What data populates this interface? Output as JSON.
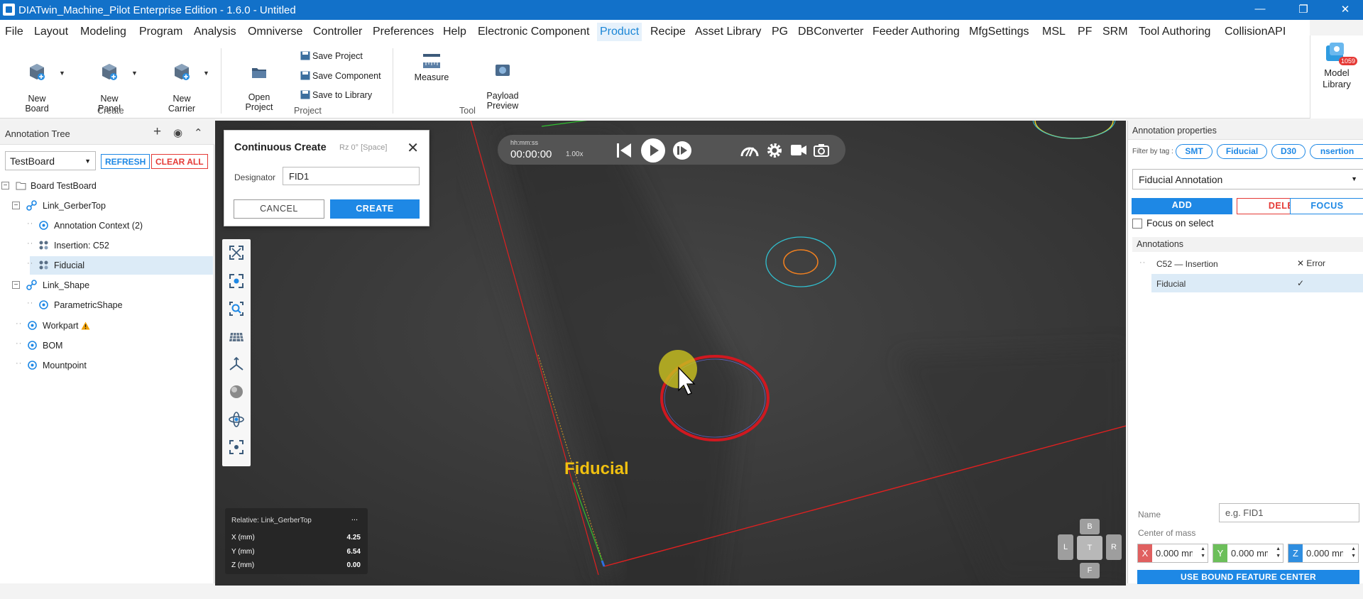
{
  "titlebar": {
    "title": "DIATwin_Machine_Pilot Enterprise Edition - 1.6.0 - Untitled",
    "minimize": "—",
    "restore": "❐",
    "close": "✕"
  },
  "menu": {
    "items": [
      "File",
      "Layout",
      "Modeling",
      "Program",
      "Analysis",
      "Omniverse",
      "Controller",
      "Preferences",
      "Help",
      "Electronic Component",
      "Product",
      "Recipe",
      "Asset Library",
      "PG",
      "DBConverter",
      "Feeder Authoring",
      "MfgSettings",
      "MSL",
      "PF",
      "SRM",
      "Tool Authoring",
      "CollisionAPI"
    ],
    "active": "Product",
    "collapse_icon": "⌃"
  },
  "ribbon": {
    "create": {
      "label": "Create",
      "new_board": "New\nBoard",
      "new_panel": "New\nPanel",
      "new_carrier": "New\nCarrier"
    },
    "project": {
      "label": "Project",
      "open_project": "Open\nProject",
      "save_project": "Save Project",
      "save_component": "Save Component",
      "save_to_library": "Save to Library"
    },
    "tool": {
      "label": "Tool",
      "measure": "Measure",
      "payload_preview": "Payload\nPreview"
    },
    "model_library": {
      "label": "Model\nLibrary",
      "badge": "1059"
    }
  },
  "tree": {
    "title": "Annotation Tree",
    "add_icon": "+",
    "eye_icon": "◉",
    "collapse_icon": "⌃",
    "board_select": "TestBoard",
    "refresh": "REFRESH",
    "clear_all": "CLEAR ALL",
    "nodes": {
      "board": "Board  TestBoard",
      "link_gerbertop": "Link_GerberTop",
      "annotation_context": "Annotation Context (2)",
      "insertion": "Insertion: C52",
      "fiducial": "Fiducial",
      "link_shape": "Link_Shape",
      "parametric_shape": "ParametricShape",
      "workpart": "Workpart",
      "bom": "BOM",
      "mountpoint": "Mountpoint"
    }
  },
  "playbar": {
    "format": "hh:mm:ss",
    "time": "00:00:00",
    "speed": "1.00x"
  },
  "dialog": {
    "title": "Continuous Create",
    "rz_hint": "Rz 0°  [Space]",
    "close": "✕",
    "designator_label": "Designator",
    "designator_value": "FID1",
    "cancel": "CANCEL",
    "create": "CREATE"
  },
  "coords": {
    "relative": "Relative: Link_GerberTop",
    "more": "...",
    "x_label": "X (mm)",
    "x_value": "4.25",
    "y_label": "Y (mm)",
    "y_value": "6.54",
    "z_label": "Z (mm)",
    "z_value": "0.00"
  },
  "viewport": {
    "fiducial_label": "Fiducial",
    "navcube": {
      "top": "B",
      "left": "L",
      "center": "T",
      "right": "R",
      "bottom": "F"
    }
  },
  "props": {
    "title": "Annotation properties",
    "filter_label": "Filter by tag :",
    "tags": [
      "SMT",
      "Fiducial",
      "D30",
      "nsertion"
    ],
    "annotation_type": "Fiducial Annotation",
    "add": "ADD",
    "delete": "DELETE",
    "focus": "FOCUS",
    "focus_on_select": "Focus on select",
    "annotations_header": "Annotations",
    "annotations": [
      {
        "name": "C52 — Insertion",
        "status": "✕ Error"
      },
      {
        "name": "Fiducial",
        "status": "✓"
      }
    ],
    "name_label": "Name",
    "name_placeholder": "e.g. FID1",
    "center_of_mass_label": "Center of mass",
    "x_tag": "X",
    "x_value": "0.000 mm",
    "y_tag": "Y",
    "y_value": "0.000 mm",
    "z_tag": "Z",
    "z_value": "0.000 mm",
    "bound_button": "USE BOUND FEATURE CENTER"
  },
  "colors": {
    "titlebar": "#1271c9",
    "accent": "#1e88e5",
    "danger": "#e53935",
    "fiducial_label": "#f0c010",
    "selection": "#dcebf7"
  }
}
